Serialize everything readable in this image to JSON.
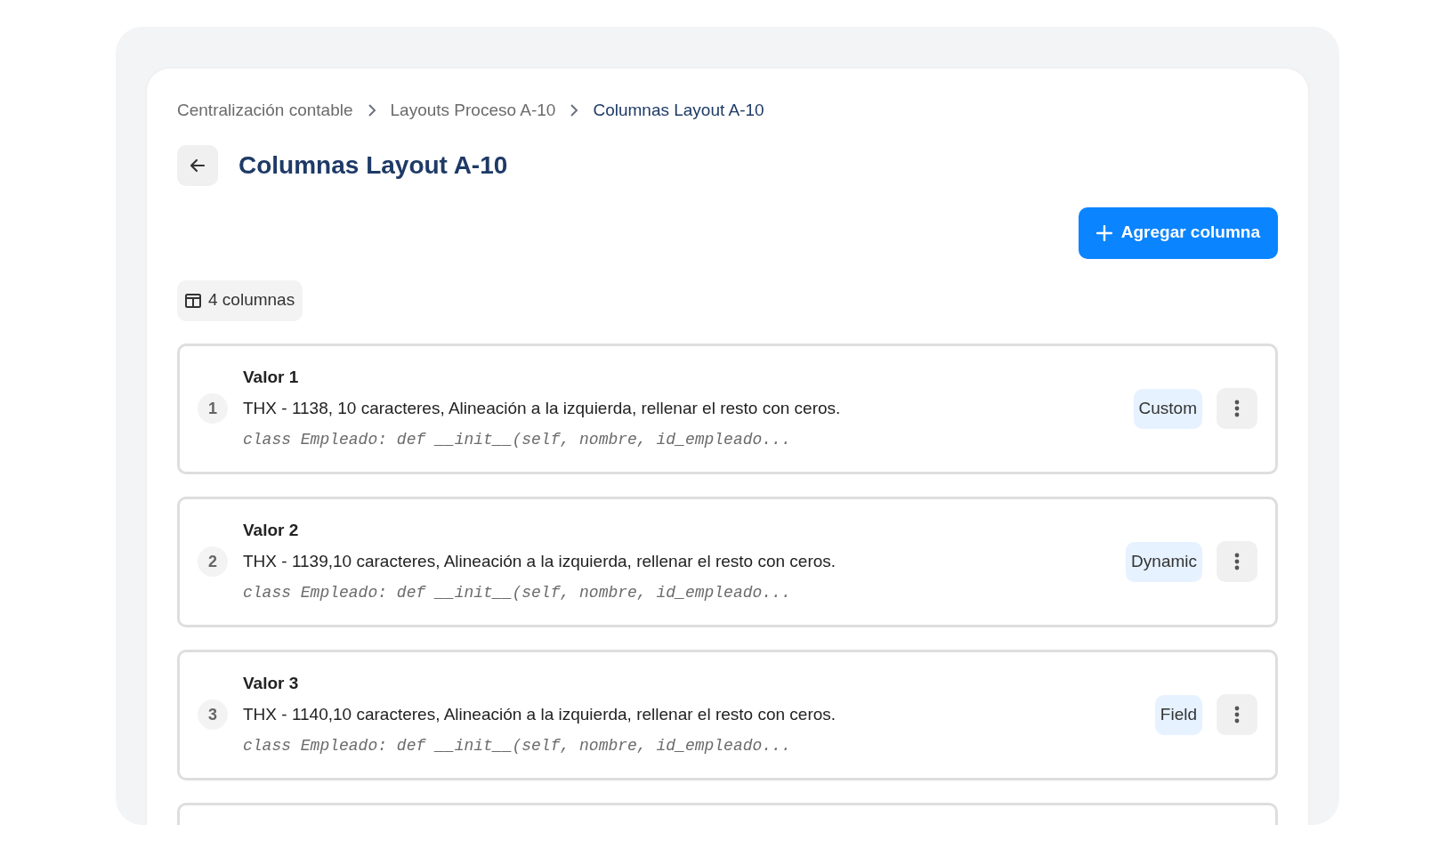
{
  "breadcrumb": [
    {
      "label": "Centralización contable",
      "selected": false
    },
    {
      "label": "Layouts Proceso A-10",
      "selected": false
    },
    {
      "label": "Columnas Layout A-10",
      "selected": true
    }
  ],
  "title": "Columnas Layout A-10",
  "add_button": {
    "label": "Agregar columna"
  },
  "count_chip": {
    "label": "4 columnas"
  },
  "columns": [
    {
      "number": "1",
      "name": "Valor 1",
      "description": "THX - 1138, 10 caracteres, Alineación a la izquierda, rellenar el resto con ceros.",
      "code": "class Empleado: def __init__(self, nombre, id_empleado...",
      "type": "Custom"
    },
    {
      "number": "2",
      "name": "Valor 2",
      "description": "THX - 1139,10 caracteres, Alineación a la izquierda, rellenar el resto con ceros.",
      "code": "class Empleado: def __init__(self, nombre, id_empleado...",
      "type": "Dynamic"
    },
    {
      "number": "3",
      "name": "Valor 3",
      "description": "THX - 1140,10 caracteres, Alineación a la izquierda, rellenar el resto con ceros.",
      "code": "class Empleado: def __init__(self, nombre, id_empleado...",
      "type": "Field"
    }
  ]
}
